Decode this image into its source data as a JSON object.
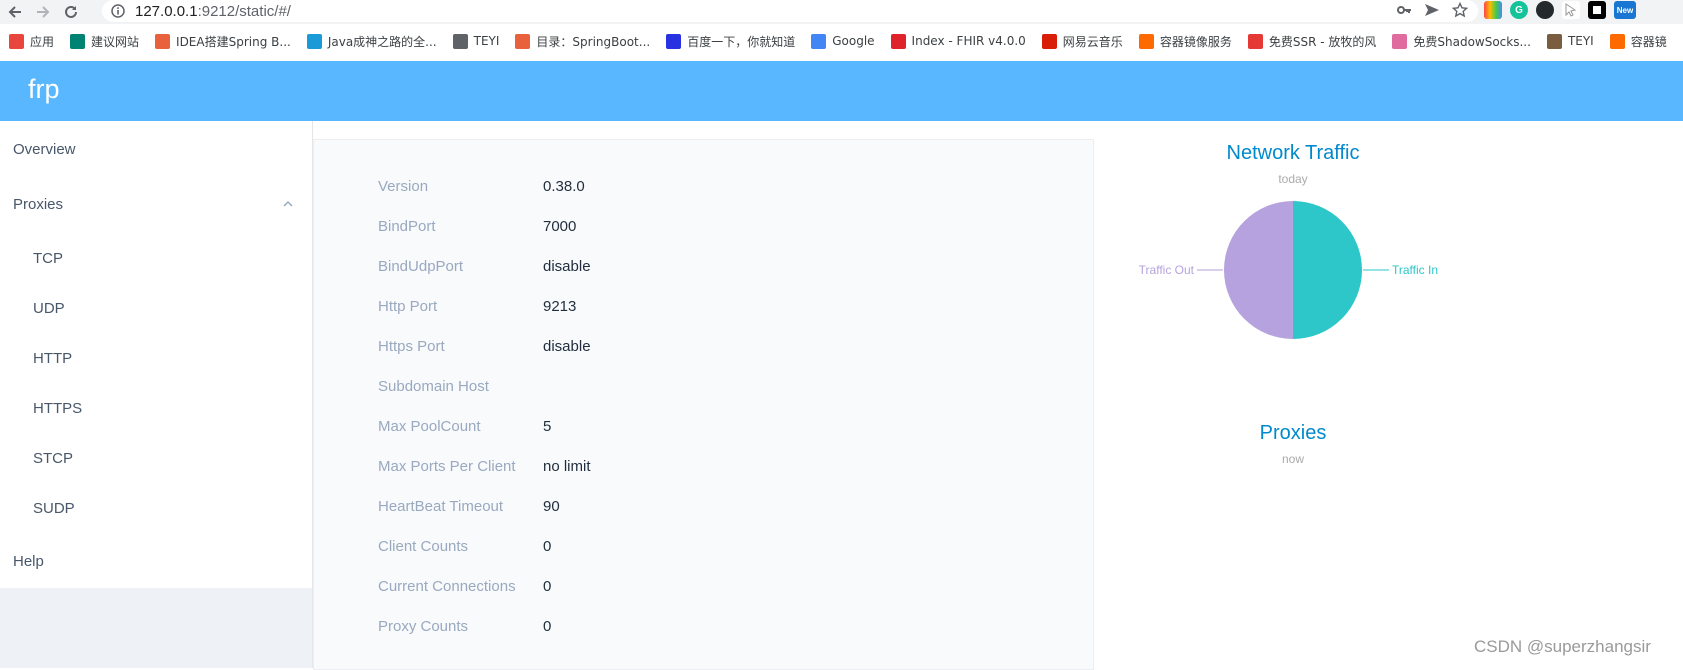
{
  "browser": {
    "url_host": "127.0.0.1",
    "url_rest": ":9212/static/#/"
  },
  "bookmarks": [
    {
      "label": "应用",
      "icon": "apps-grid-icon",
      "color": "#e8453c"
    },
    {
      "label": "建议网站",
      "icon": "bing-icon",
      "color": "#008373"
    },
    {
      "label": "IDEA搭建Spring B...",
      "icon": "jian-icon",
      "color": "#e8613c"
    },
    {
      "label": "Java成神之路的全...",
      "icon": "cloud-icon",
      "color": "#1a9bd7"
    },
    {
      "label": "TEYI",
      "icon": "globe-icon",
      "color": "#5f6368"
    },
    {
      "label": "目录：SpringBoot...",
      "icon": "jian-icon",
      "color": "#e8613c"
    },
    {
      "label": "百度一下，你就知道",
      "icon": "baidu-paw-icon",
      "color": "#2932e1"
    },
    {
      "label": "Google",
      "icon": "google-icon",
      "color": "#4285f4"
    },
    {
      "label": "Index - FHIR v4.0.0",
      "icon": "fhir-icon",
      "color": "#e0222a"
    },
    {
      "label": "网易云音乐",
      "icon": "netease-music-icon",
      "color": "#d81e06"
    },
    {
      "label": "容器镜像服务",
      "icon": "aliyun-icon",
      "color": "#ff6a00"
    },
    {
      "label": "免费SSR - 放牧的风",
      "icon": "flag-icon",
      "color": "#e53935"
    },
    {
      "label": "免费ShadowSocks...",
      "icon": "paper-plane-icon",
      "color": "#e06c9f"
    },
    {
      "label": "TEYI",
      "icon": "image-icon",
      "color": "#7a5c3e"
    },
    {
      "label": "容器镜",
      "icon": "aliyun-icon",
      "color": "#ff6a00"
    }
  ],
  "app": {
    "brand": "frp",
    "menu": {
      "overview": "Overview",
      "proxies": "Proxies",
      "sub": [
        "TCP",
        "UDP",
        "HTTP",
        "HTTPS",
        "STCP",
        "SUDP"
      ],
      "help": "Help"
    },
    "info": [
      {
        "k": "Version",
        "v": "0.38.0"
      },
      {
        "k": "BindPort",
        "v": "7000"
      },
      {
        "k": "BindUdpPort",
        "v": "disable"
      },
      {
        "k": "Http Port",
        "v": "9213"
      },
      {
        "k": "Https Port",
        "v": "disable"
      },
      {
        "k": "Subdomain Host",
        "v": ""
      },
      {
        "k": "Max PoolCount",
        "v": "5"
      },
      {
        "k": "Max Ports Per Client",
        "v": "no limit"
      },
      {
        "k": "HeartBeat Timeout",
        "v": "90"
      },
      {
        "k": "Client Counts",
        "v": "0"
      },
      {
        "k": "Current Connections",
        "v": "0"
      },
      {
        "k": "Proxy Counts",
        "v": "0"
      }
    ],
    "traffic_chart": {
      "title": "Network Traffic",
      "subtitle": "today"
    },
    "proxies_chart": {
      "title": "Proxies",
      "subtitle": "now"
    }
  },
  "chart_data": {
    "type": "pie",
    "title": "Network Traffic",
    "subtitle": "today",
    "labels": [
      "Traffic In",
      "Traffic Out"
    ],
    "values": [
      50,
      50
    ],
    "colors": [
      "#2ec7c9",
      "#b6a2de"
    ]
  },
  "watermark": "CSDN @superzhangsir"
}
